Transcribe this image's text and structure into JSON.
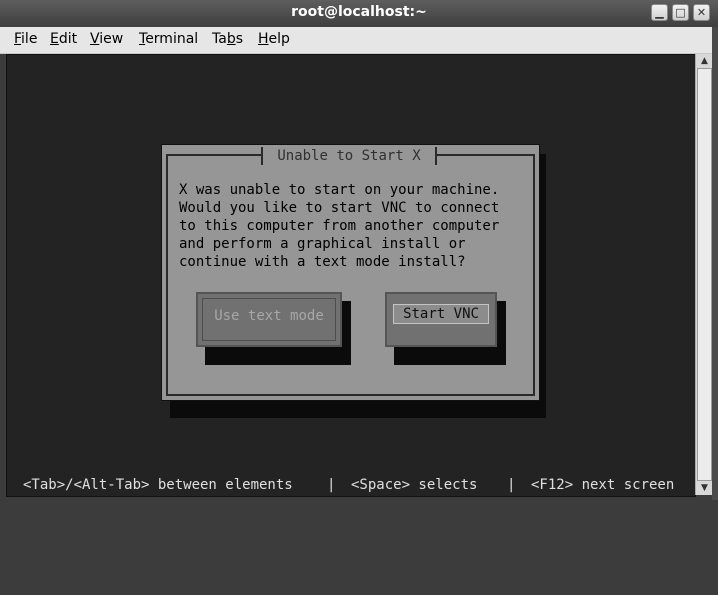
{
  "window": {
    "title": "root@localhost:~",
    "controls": {
      "minimize": "▁",
      "maximize": "□",
      "close": "✕"
    }
  },
  "menu": {
    "file": {
      "mnemonic": "F",
      "rest": "ile"
    },
    "edit": {
      "mnemonic": "E",
      "rest": "dit"
    },
    "view": {
      "mnemonic": "V",
      "rest": "iew"
    },
    "terminal": {
      "mnemonic": "T",
      "rest": "erminal"
    },
    "tabs": {
      "pre": "Ta",
      "mnemonic": "b",
      "rest": "s"
    },
    "help": {
      "mnemonic": "H",
      "rest": "elp"
    }
  },
  "dialog": {
    "title": "Unable to Start X",
    "message": "X was unable to start on your machine.\nWould you like to start VNC to connect\nto this computer from another computer\nand perform a graphical install or\ncontinue with a text mode install?",
    "buttons": {
      "text_mode": "Use text mode",
      "start_vnc": "Start VNC"
    },
    "focused_button": "Start VNC"
  },
  "status_bar": {
    "tab_hint": "<Tab>/<Alt-Tab> between elements",
    "sep1": "|",
    "space_hint": "<Space> selects",
    "sep2": "|",
    "f12_hint": "<F12> next screen"
  },
  "scrollbar": {
    "up_icon": "▲",
    "down_icon": "▼"
  },
  "colors": {
    "terminal_bg": "#232323",
    "dialog_bg": "#969696",
    "button_bg": "#717171",
    "status_text": "#e0e0e0"
  }
}
